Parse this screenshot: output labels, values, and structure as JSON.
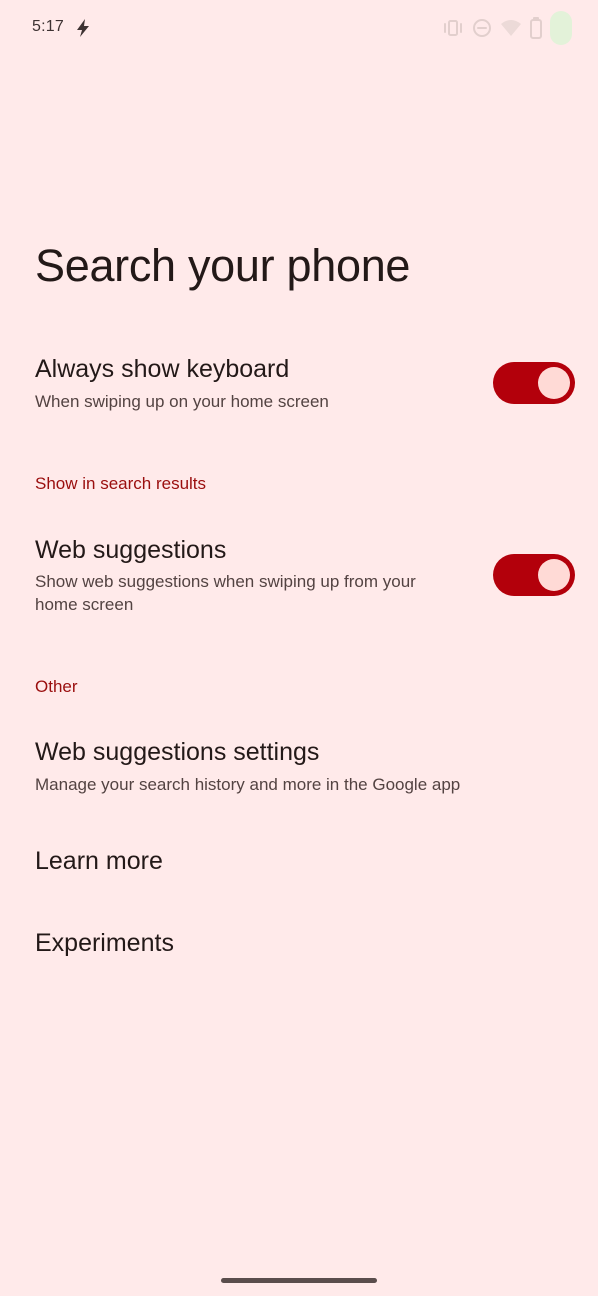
{
  "status_bar": {
    "time": "5:17"
  },
  "page": {
    "title": "Search your phone"
  },
  "settings": {
    "always_show_keyboard": {
      "title": "Always show keyboard",
      "subtitle": "When swiping up on your home screen",
      "enabled": true
    },
    "section_show_in_results": "Show in search results",
    "web_suggestions": {
      "title": "Web suggestions",
      "subtitle_line1": "Show web suggestions when swiping up from your",
      "subtitle_line2": "home screen",
      "enabled": true
    },
    "section_other": "Other",
    "web_suggestions_settings": {
      "title": "Web suggestions settings",
      "subtitle": "Manage your search history and more in the Google app"
    },
    "learn_more": {
      "title": "Learn more"
    },
    "experiments": {
      "title": "Experiments"
    }
  },
  "colors": {
    "background": "#ffeaea",
    "accent": "#b3000b",
    "section_header": "#9a0e0e"
  }
}
